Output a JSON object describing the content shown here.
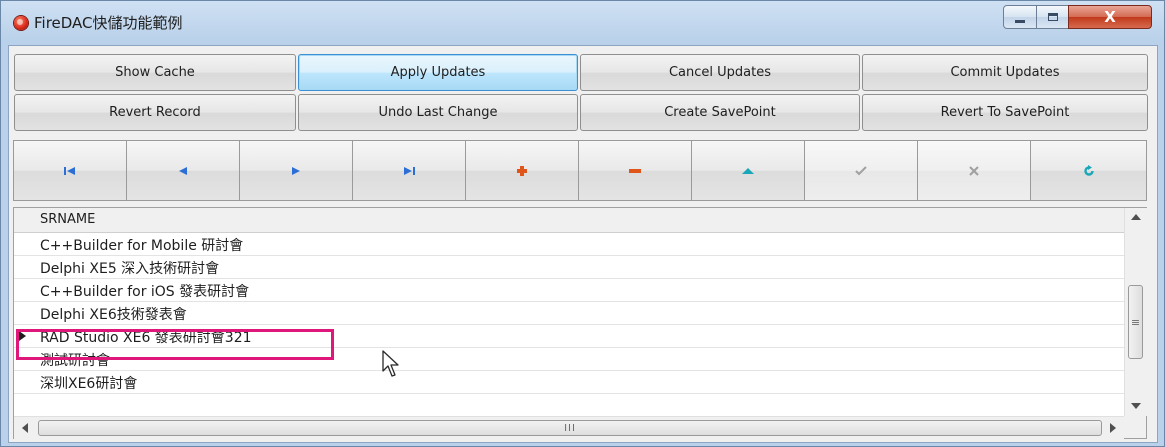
{
  "window": {
    "title": "FireDAC快儲功能範例",
    "close_glyph": "X"
  },
  "toolbar_row1": [
    "Show Cache",
    "Apply Updates",
    "Cancel Updates",
    "Commit Updates"
  ],
  "toolbar_row2": [
    "Revert Record",
    "Undo Last Change",
    "Create SavePoint",
    "Revert To SavePoint"
  ],
  "navigator": [
    {
      "name": "first-record-icon",
      "color": "#2b6fd6"
    },
    {
      "name": "prior-record-icon",
      "color": "#2b6fd6"
    },
    {
      "name": "next-record-icon",
      "color": "#2b6fd6"
    },
    {
      "name": "last-record-icon",
      "color": "#2b6fd6"
    },
    {
      "name": "insert-record-icon",
      "color": "#e0561a"
    },
    {
      "name": "delete-record-icon",
      "color": "#e0561a"
    },
    {
      "name": "edit-record-icon",
      "color": "#1aa7b8"
    },
    {
      "name": "post-record-icon",
      "color": "#9a9a9a",
      "disabled": true
    },
    {
      "name": "cancel-record-icon",
      "color": "#9a9a9a",
      "disabled": true
    },
    {
      "name": "refresh-records-icon",
      "color": "#1aa7b8"
    }
  ],
  "grid": {
    "column_header": "SRNAME",
    "rows": [
      "C++Builder for Mobile 研討會",
      "Delphi XE5 深入技術研討會",
      "C++Builder for iOS 發表研討會",
      "Delphi XE6技術發表會",
      "RAD Studio XE6 發表研討會321",
      "測試研討會",
      "深圳XE6研討會"
    ],
    "current_row_index": 4,
    "vscroll_grip": "≡",
    "hscroll_grip": "III"
  },
  "colors": {
    "highlight": "#e0177a",
    "focus_border": "#3c8fd1"
  }
}
